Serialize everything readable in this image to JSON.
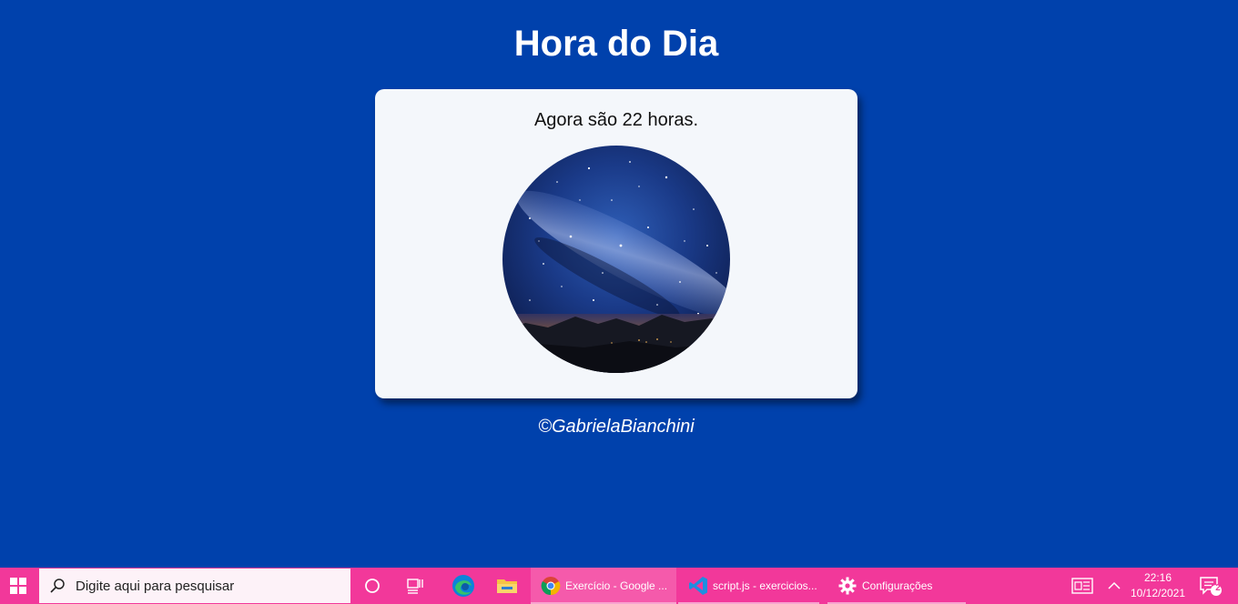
{
  "page": {
    "title": "Hora do Dia",
    "message": "Agora são 22 horas.",
    "footer": "©GabrielaBianchini",
    "image_name": "night-sky-image"
  },
  "colors": {
    "background": "#0041ac",
    "card": "#f4f7fb",
    "taskbar": "#f2389a"
  },
  "taskbar": {
    "search_placeholder": "Digite aqui para pesquisar",
    "apps": [
      {
        "label": "Exercício - Google ...",
        "icon": "chrome-icon",
        "active": true
      },
      {
        "label": "script.js - exercicios...",
        "icon": "vscode-icon",
        "active": false
      },
      {
        "label": "Configurações",
        "icon": "gear-icon",
        "active": false
      }
    ],
    "pinned": [
      "cortana-icon",
      "task-view-icon",
      "edge-icon",
      "file-explorer-icon"
    ],
    "clock_time": "22:16",
    "clock_date": "10/12/2021",
    "notification_count": "2"
  }
}
